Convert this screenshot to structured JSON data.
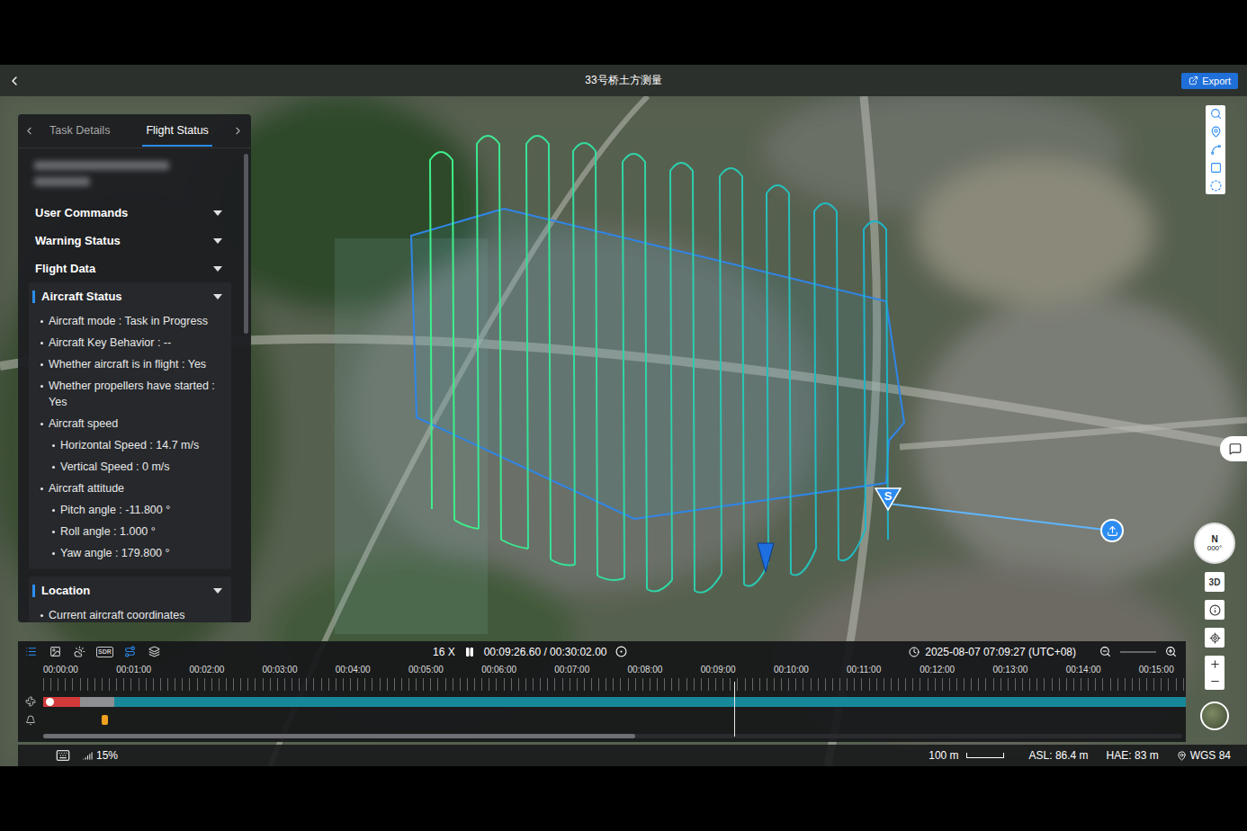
{
  "window": {
    "title": "33号桥土方测量",
    "export": "Export"
  },
  "panel": {
    "tabs": [
      {
        "label": "Task Details",
        "selected": false
      },
      {
        "label": "Flight Status",
        "selected": true
      }
    ],
    "sections": [
      {
        "title": "User Commands",
        "expanded": false,
        "items": []
      },
      {
        "title": "Warning Status",
        "expanded": false,
        "items": []
      },
      {
        "title": "Flight Data",
        "expanded": false,
        "items": []
      },
      {
        "title": "Aircraft Status",
        "expanded": true,
        "items": [
          {
            "text": "Aircraft mode : Task in Progress",
            "level": 1
          },
          {
            "text": "Aircraft Key Behavior : --",
            "level": 1
          },
          {
            "text": "Whether aircraft is in flight : Yes",
            "level": 1
          },
          {
            "text": "Whether propellers have started : Yes",
            "level": 1
          },
          {
            "text": "Aircraft speed",
            "level": 1
          },
          {
            "text": "Horizontal Speed : 14.7 m/s",
            "level": 2
          },
          {
            "text": "Vertical Speed : 0 m/s",
            "level": 2
          },
          {
            "text": "Aircraft attitude",
            "level": 1
          },
          {
            "text": "Pitch angle : -11.800 °",
            "level": 2
          },
          {
            "text": "Roll angle : 1.000 °",
            "level": 2
          },
          {
            "text": "Yaw angle : 179.800 °",
            "level": 2
          }
        ]
      },
      {
        "title": "Location",
        "expanded": true,
        "items": [
          {
            "text": "Current aircraft coordinates",
            "level": 1
          }
        ]
      }
    ]
  },
  "map": {
    "start_marker": "S",
    "compass": {
      "label": "N",
      "heading": "000°"
    },
    "view_button": "3D"
  },
  "timeline": {
    "tools": [
      {
        "kind": "list",
        "label": "",
        "selected": true
      },
      {
        "kind": "image",
        "label": "",
        "selected": false
      },
      {
        "kind": "weather",
        "label": "",
        "selected": false
      },
      {
        "kind": "sdr",
        "label": "SDR",
        "selected": false
      },
      {
        "kind": "route",
        "label": "",
        "selected": true
      },
      {
        "kind": "layers",
        "label": "",
        "selected": false
      }
    ],
    "speed": "16 X",
    "playing": true,
    "time": "00:09:26.60 / 00:30:02.00",
    "clock": "2025-08-07 07:09:27 (UTC+08)",
    "ticks": [
      "00:00:00",
      "00:01:00",
      "00:02:00",
      "00:03:00",
      "00:04:00",
      "00:05:00",
      "00:06:00",
      "00:07:00",
      "00:08:00",
      "00:09:00",
      "00:10:00",
      "00:11:00",
      "00:12:00",
      "00:13:00",
      "00:14:00",
      "00:15:00"
    ],
    "playhead": 0.605,
    "segments": [
      {
        "share": 0.032,
        "color": "#d23a3a"
      },
      {
        "share": 0.03,
        "color": "#8d8f93"
      },
      {
        "share": 0.938,
        "color": "#17889a"
      }
    ],
    "alerts": [
      {
        "position": 0.051,
        "color": "#f0a020"
      }
    ],
    "scroll": 0.52
  },
  "status_bar": {
    "signal": "15%",
    "scale": "100 m",
    "asl": "ASL: 86.4 m",
    "hae": "HAE: 83 m",
    "datum": "WGS 84"
  }
}
